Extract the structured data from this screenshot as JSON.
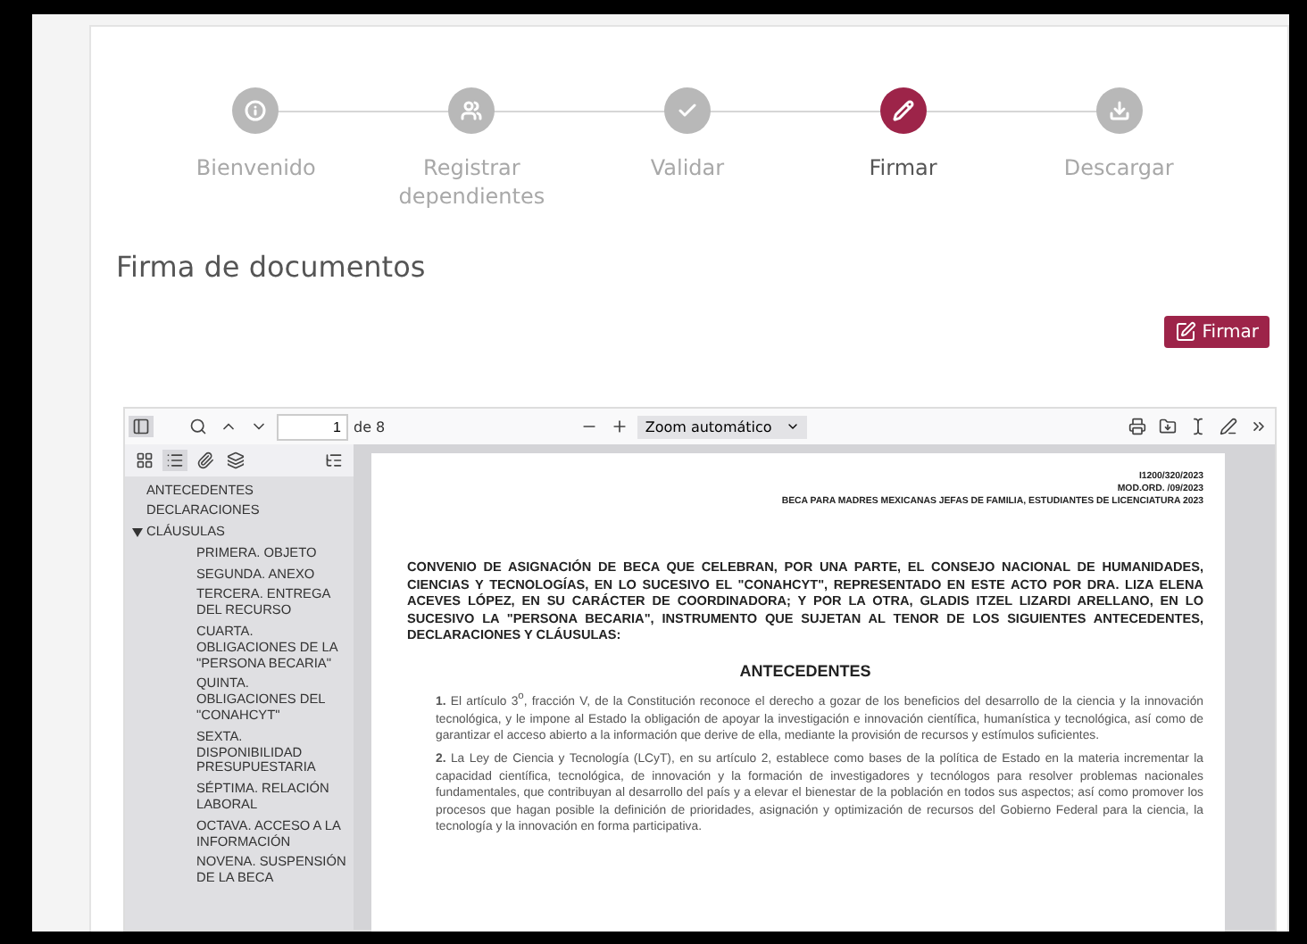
{
  "steps": [
    {
      "label": "Bienvenido",
      "selected": false
    },
    {
      "label": "Registrar dependientes",
      "selected": false
    },
    {
      "label": "Validar",
      "selected": false
    },
    {
      "label": "Firmar",
      "selected": true
    },
    {
      "label": "Descargar",
      "selected": false
    }
  ],
  "title": "Firma de documentos",
  "sign_button": "Firmar",
  "viewer": {
    "page": "1",
    "page_count": "de 8",
    "zoom": "Zoom automático",
    "sidebar_tabs": [
      {
        "selected": false
      },
      {
        "selected": true
      },
      {
        "selected": false
      },
      {
        "selected": false
      }
    ],
    "outline": [
      {
        "label": "ANTECEDENTES"
      },
      {
        "label": "DECLARACIONES"
      },
      {
        "label": "CLÁUSULAS",
        "expanded": true,
        "children": [
          {
            "label": "PRIMERA. OBJETO"
          },
          {
            "label": "SEGUNDA. ANEXO"
          },
          {
            "label": "TERCERA. ENTREGA DEL RECURSO"
          },
          {
            "label": "CUARTA. OBLIGACIONES DE LA \"PERSONA BECARIA\""
          },
          {
            "label": "QUINTA. OBLIGACIONES DEL \"CONAHCYT\""
          },
          {
            "label": "SEXTA. DISPONIBILIDAD PRESUPUESTARIA"
          },
          {
            "label": "SÉPTIMA. RELACIÓN LABORAL"
          },
          {
            "label": "OCTAVA. ACCESO A LA INFORMACIÓN"
          },
          {
            "label": "NOVENA. SUSPENSIÓN DE LA BECA"
          }
        ]
      }
    ],
    "document": {
      "header": [
        "I1200/320/2023",
        "MOD.ORD. /09/2023",
        "BECA PARA MADRES MEXICANAS JEFAS DE FAMILIA, ESTUDIANTES DE LICENCIATURA 2023"
      ],
      "preamble": "CONVENIO DE ASIGNACIÓN DE BECA QUE CELEBRAN, POR UNA PARTE, EL CONSEJO NACIONAL DE HUMANIDADES, CIENCIAS Y TECNOLOGÍAS, EN LO SUCESIVO EL \"CONAHCYT\", REPRESENTADO EN ESTE ACTO POR DRA. LIZA ELENA ACEVES LÓPEZ, EN SU CARÁCTER DE COORDINADORA; Y POR LA OTRA, GLADIS ITZEL LIZARDI ARELLANO, EN LO SUCESIVO LA \"PERSONA BECARIA\", INSTRUMENTO QUE SUJETAN AL TENOR DE LOS SIGUIENTES ANTECEDENTES, DECLARACIONES Y CLÁUSULAS:",
      "section": "ANTECEDENTES",
      "paragraphs": [
        "**1.** El artículo 3$^{o}$, fracción V, de la Constitución reconoce el derecho a gozar de los beneficios del desarrollo de la ciencia y la innovación tecnológica, y le impone al Estado la obligación de apoyar la investigación e innovación científica, humanística y tecnológica, así como de garantizar el acceso abierto a la información que derive de ella, mediante la provisión de recursos y estímulos suficientes.",
        "**2.** La Ley de Ciencia y Tecnología (LCyT), en su artículo 2, establece como bases de la política de Estado en la materia incrementar la capacidad científica, tecnológica, de innovación y la formación de investigadores y tecnólogos para resolver problemas nacionales fundamentales, que contribuyan al desarrollo del país y a elevar el bienestar de la población en todos sus aspectos; así como promover los procesos que hagan posible la definición de prioridades, asignación y optimización de recursos del Gobierno Federal para la ciencia, la tecnología y la innovación en forma participativa."
      ]
    }
  }
}
